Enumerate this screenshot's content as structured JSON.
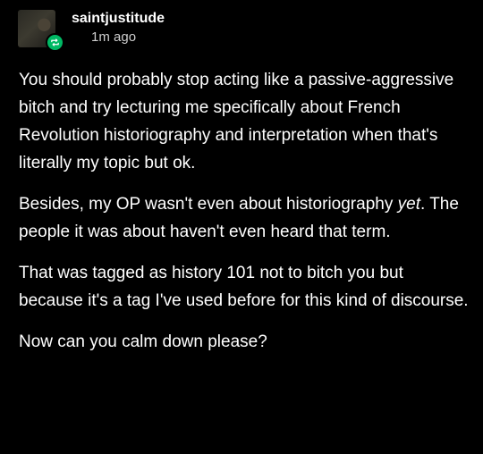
{
  "post": {
    "author": {
      "username": "saintjustitude",
      "avatar_icon": "avatar-image",
      "badge_icon": "reblog-icon",
      "badge_color": "#00b964"
    },
    "timestamp": "1m ago",
    "paragraphs": [
      {
        "text": "You should probably stop acting like a passive-aggressive bitch and try lecturing me specifically about French Revolution historiography and interpretation when that's literally my topic but ok."
      },
      {
        "italic_lead": "yet",
        "lead": "Besides, my OP wasn't even about historiography ",
        "tail": ". The people it was about haven't even heard that term."
      },
      {
        "text": "That was tagged as history 101 not to bitch you but because it's a tag I've used before for this kind of discourse."
      },
      {
        "text": "Now can you calm down please?"
      }
    ]
  },
  "theme": {
    "background": "#000000",
    "text": "#ffffff",
    "muted_text": "#cfcfcf"
  }
}
